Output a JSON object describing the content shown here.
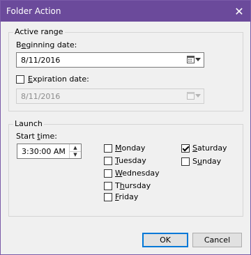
{
  "window": {
    "title": "Folder Action",
    "close_glyph": "✕"
  },
  "active_range": {
    "legend": "Active range",
    "beginning": {
      "label_pre": "B",
      "label_u": "e",
      "label_post": "ginning date:",
      "value": "8/11/2016"
    },
    "expiration": {
      "label_pre": "",
      "label_u": "E",
      "label_post": "xpiration date:",
      "checked": false,
      "value": "8/11/2016"
    }
  },
  "launch": {
    "legend": "Launch",
    "start_time": {
      "label_pre": "Start ",
      "label_u": "t",
      "label_post": "ime:",
      "value": "3:30:00 AM"
    },
    "days": [
      {
        "pre": "",
        "u": "M",
        "post": "onday",
        "checked": false
      },
      {
        "pre": "",
        "u": "T",
        "post": "uesday",
        "checked": false
      },
      {
        "pre": "",
        "u": "W",
        "post": "ednesday",
        "checked": false
      },
      {
        "pre": "T",
        "u": "h",
        "post": "ursday",
        "checked": false
      },
      {
        "pre": "",
        "u": "F",
        "post": "riday",
        "checked": false
      },
      {
        "pre": "",
        "u": "S",
        "post": "aturday",
        "checked": true
      },
      {
        "pre": "S",
        "u": "u",
        "post": "nday",
        "checked": false
      }
    ]
  },
  "buttons": {
    "ok": "OK",
    "cancel": "Cancel"
  },
  "icons": {
    "calendar": "calendar-icon",
    "dropdown": "chevron-down-icon",
    "close": "close-icon"
  }
}
